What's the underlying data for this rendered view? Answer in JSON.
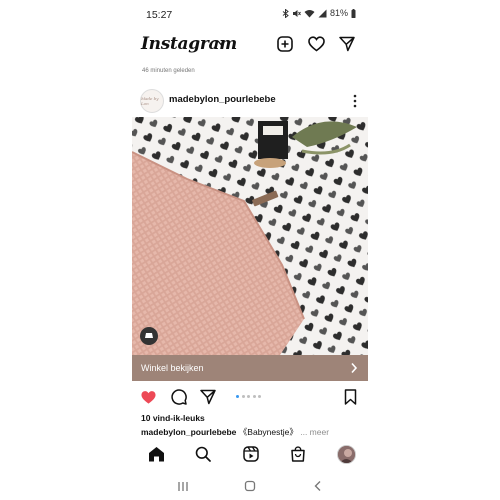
{
  "status_bar": {
    "time": "15:27",
    "battery": "81%"
  },
  "header": {
    "logo": "Instagram"
  },
  "feed": {
    "previous_post_time": "46 minuten geleden"
  },
  "post": {
    "username": "madebylon_pourlebebe",
    "avatar_text": "Made by Lon",
    "shop_label": "Winkel bekijken",
    "likes": "10 vind-ik-leuks",
    "caption_user": "madebylon_pourlebebe",
    "caption_text": "《Babynestje》",
    "caption_more": "... meer",
    "liked": true,
    "carousel_count": 5,
    "carousel_active": 1
  },
  "colors": {
    "like": "#ed4956",
    "shop_bar": "#9e8478",
    "carousel_active": "#3897f0"
  },
  "icons": {
    "header": [
      "new-post-icon",
      "heart-icon",
      "direct-message-icon"
    ],
    "post_actions": [
      "like-icon",
      "comment-icon",
      "share-icon",
      "save-icon"
    ],
    "bottom_nav": [
      "home-icon",
      "search-icon",
      "reels-icon",
      "shop-icon",
      "profile-icon"
    ],
    "system_nav": [
      "recent-apps-icon",
      "home-button-icon",
      "back-icon"
    ]
  }
}
